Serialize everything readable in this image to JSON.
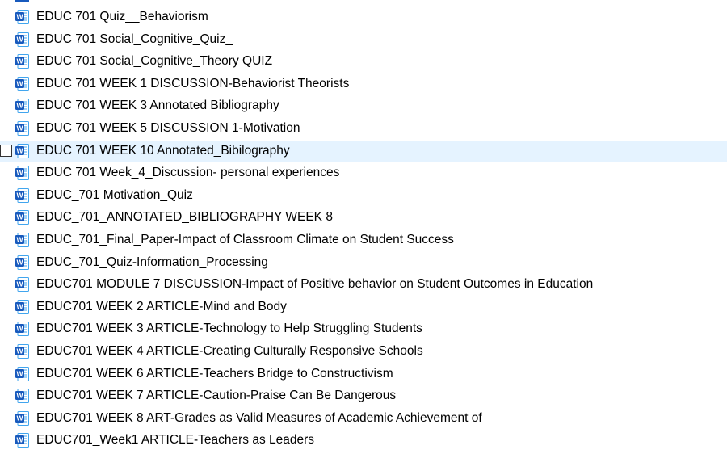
{
  "files": [
    {
      "name": "EDUC 701 Quiz__Behaviorism",
      "type": "word-doc"
    },
    {
      "name": "EDUC 701 Social_Cognitive_Quiz_",
      "type": "word-doc"
    },
    {
      "name": "EDUC 701 Social_Cognitive_Theory QUIZ",
      "type": "word-doc"
    },
    {
      "name": "EDUC 701 WEEK 1 DISCUSSION-Behaviorist Theorists",
      "type": "word-doc"
    },
    {
      "name": "EDUC 701 WEEK 3 Annotated Bibliography",
      "type": "word-doc"
    },
    {
      "name": "EDUC 701 WEEK 5 DISCUSSION 1-Motivation",
      "type": "word-doc"
    },
    {
      "name": "EDUC 701 WEEK 10 Annotated_Bibilography",
      "type": "word-doc",
      "hover": true
    },
    {
      "name": "EDUC 701 Week_4_Discussion- personal experiences",
      "type": "word-doc"
    },
    {
      "name": "EDUC_701 Motivation_Quiz",
      "type": "word-doc"
    },
    {
      "name": "EDUC_701_ANNOTATED_BIBLIOGRAPHY WEEK 8",
      "type": "word-doc"
    },
    {
      "name": "EDUC_701_Final_Paper-Impact of Classroom Climate on Student Success",
      "type": "word-doc"
    },
    {
      "name": "EDUC_701_Quiz-Information_Processing",
      "type": "word-doc"
    },
    {
      "name": "EDUC701 MODULE  7 DISCUSSION-Impact of Positive behavior on Student Outcomes in Education",
      "type": "word-doc"
    },
    {
      "name": "EDUC701 WEEK 2 ARTICLE-Mind and Body",
      "type": "word-doc"
    },
    {
      "name": "EDUC701 WEEK 3 ARTICLE-Technology to Help Struggling Students",
      "type": "word-doc"
    },
    {
      "name": "EDUC701 WEEK 4 ARTICLE-Creating Culturally Responsive Schools",
      "type": "word-doc"
    },
    {
      "name": "EDUC701 WEEK 6 ARTICLE-Teachers Bridge to Constructivism",
      "type": "word-doc"
    },
    {
      "name": "EDUC701 WEEK 7 ARTICLE-Caution-Praise Can Be Dangerous",
      "type": "word-doc"
    },
    {
      "name": "EDUC701 WEEK 8 ART-Grades as Valid Measures of Academic Achievement of",
      "type": "word-doc"
    },
    {
      "name": "EDUC701_Week1 ARTICLE-Teachers as Leaders",
      "type": "word-doc"
    }
  ],
  "colors": {
    "hover_background": "#e5f3ff",
    "word_blue": "#185abd",
    "word_light": "#41a5ee",
    "text": "#000000"
  }
}
